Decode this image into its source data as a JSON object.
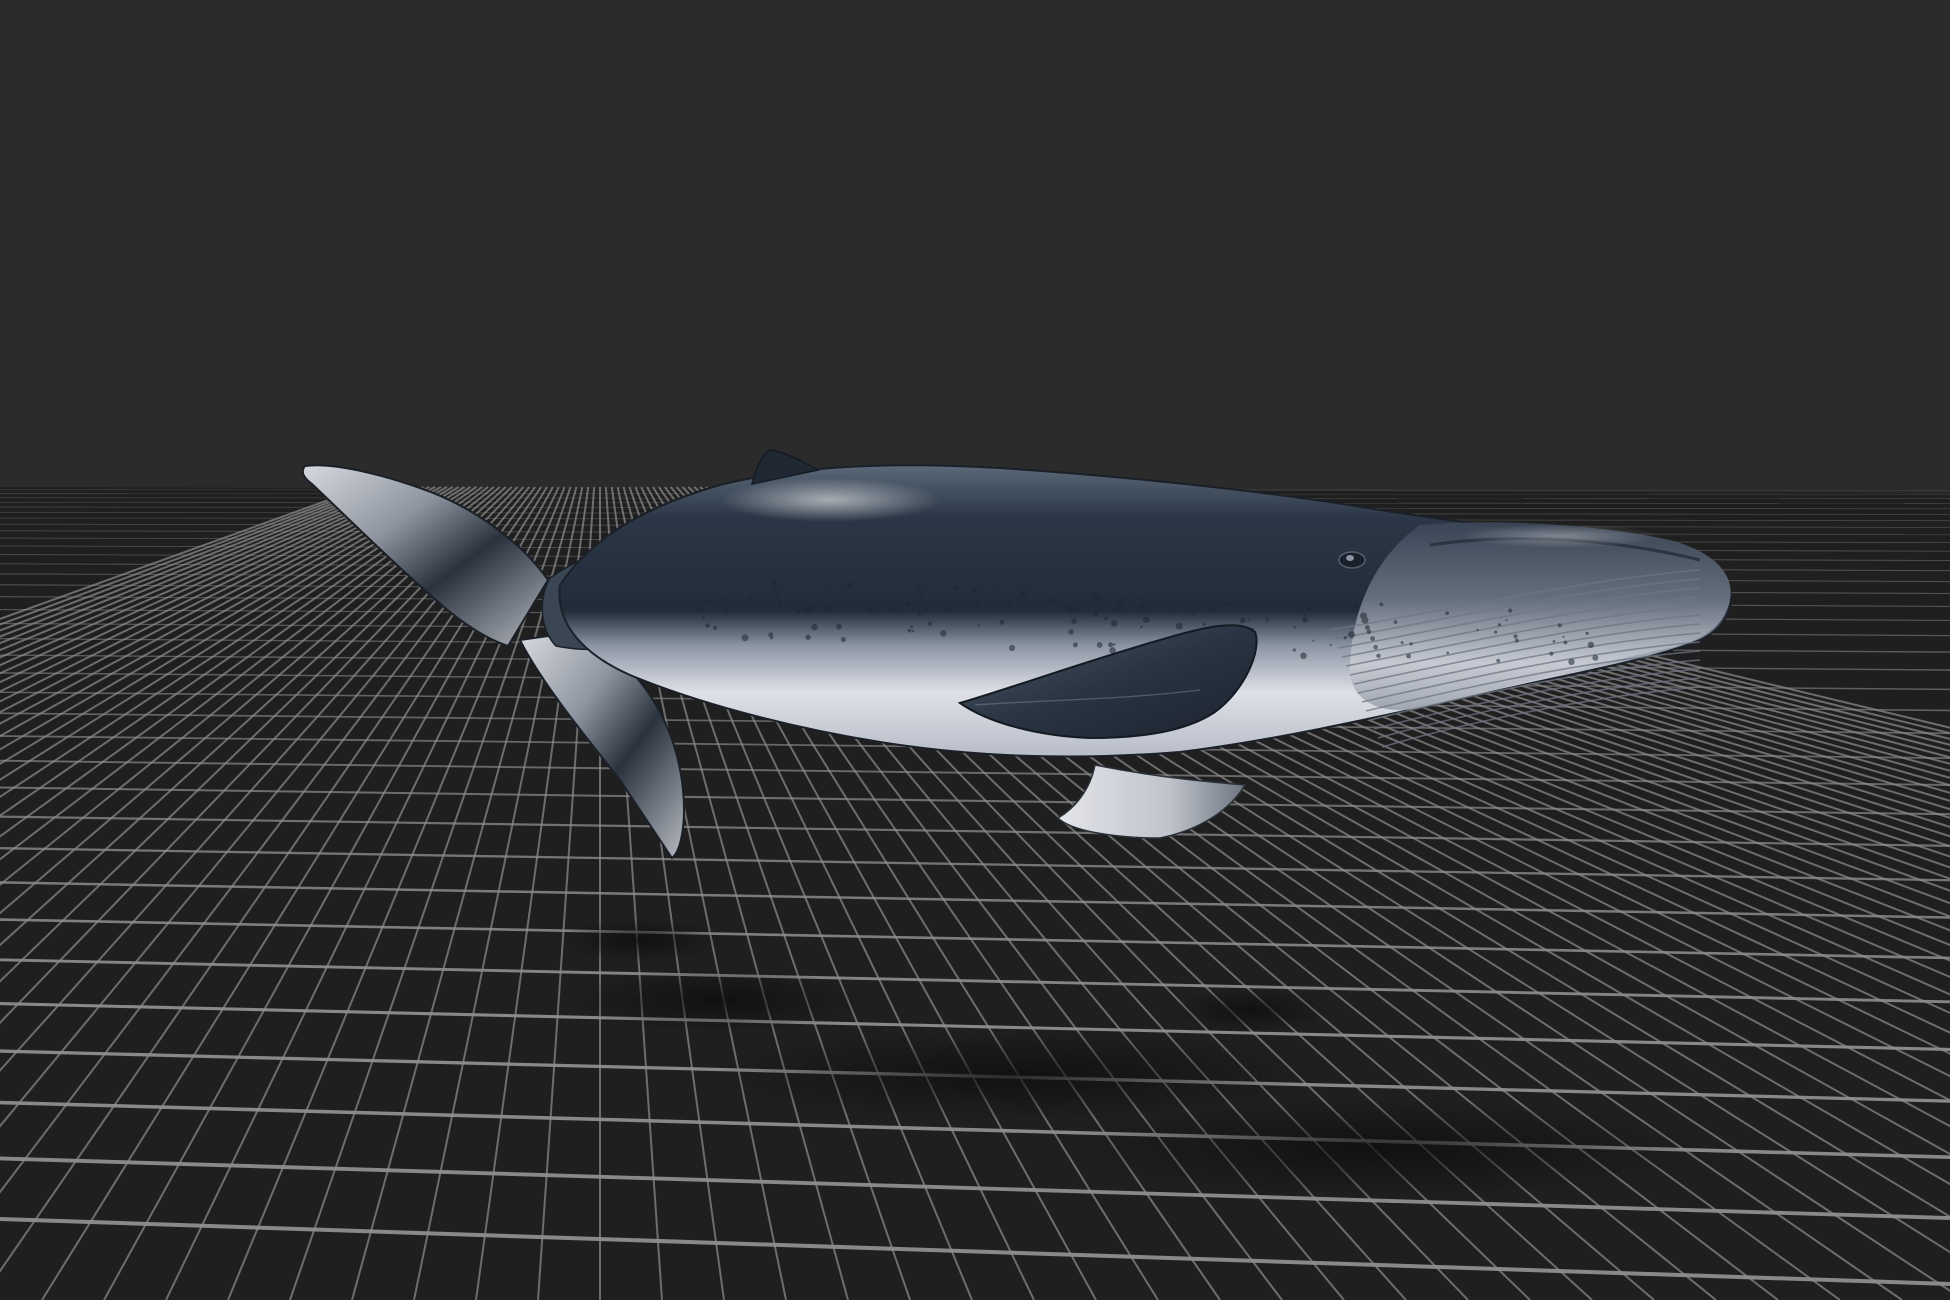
{
  "viewport": {
    "background_color": "#2b2b2b",
    "ground_color": "#1f1f1f",
    "grid_line_color": "#8f8f8f",
    "grid_visible": true,
    "shadow_visible": true
  },
  "model": {
    "subject": "humpback-whale",
    "back_color": "#26313f",
    "belly_color": "#dfe0e7",
    "fin_color": "#2f3a47"
  }
}
